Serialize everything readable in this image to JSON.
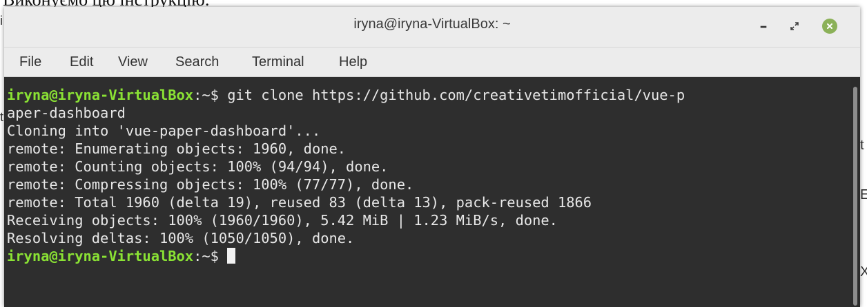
{
  "background": {
    "doc_text": "Виконуємо цю інструкцію:",
    "right_edge": [
      "t",
      "t",
      "",
      "E",
      "",
      "",
      "X"
    ],
    "left_edge": [
      "i",
      "t"
    ]
  },
  "window": {
    "title": "iryna@iryna-VirtualBox: ~",
    "controls": {
      "minimize_icon": "minimize-icon",
      "maximize_icon": "maximize-icon",
      "close_icon": "close-icon"
    }
  },
  "menu": [
    "File",
    "Edit",
    "View",
    "Search",
    "Terminal",
    "Help"
  ],
  "terminal": {
    "prompt_user": "iryna@iryna-VirtualBox",
    "prompt_path": ":~$ ",
    "command": "git clone https://github.com/creativetimofficial/vue-p",
    "command_wrap": "aper-dashboard",
    "output": [
      "Cloning into 'vue-paper-dashboard'...",
      "remote: Enumerating objects: 1960, done.",
      "remote: Counting objects: 100% (94/94), done.",
      "remote: Compressing objects: 100% (77/77), done.",
      "remote: Total 1960 (delta 19), reused 83 (delta 13), pack-reused 1866",
      "Receiving objects: 100% (1960/1960), 5.42 MiB | 1.23 MiB/s, done.",
      "Resolving deltas: 100% (1050/1050), done."
    ]
  },
  "colors": {
    "prompt_user": "#8ae234",
    "terminal_bg": "#2e2e2e",
    "terminal_fg": "#e7e7e7",
    "titlebar_bg": "#ececec",
    "close_button": "#8bb158"
  }
}
